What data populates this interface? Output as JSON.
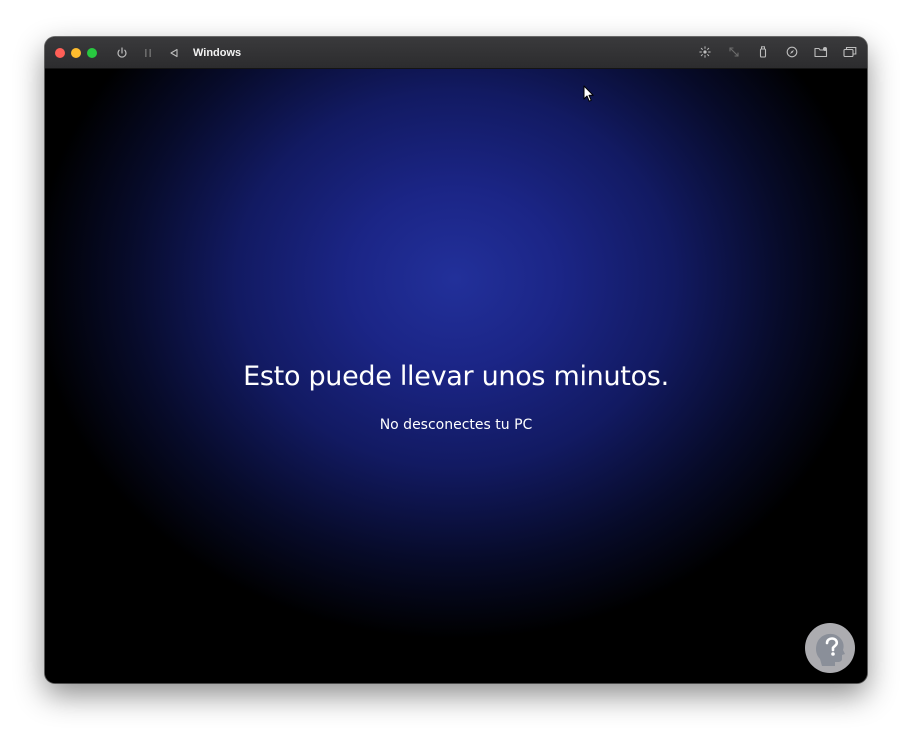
{
  "window": {
    "title": "Windows",
    "traffic_lights": {
      "close": "#ff5f57",
      "minimize": "#febc2e",
      "zoom": "#28c840"
    }
  },
  "toolbar": {
    "left_icons": [
      "power-icon",
      "pause-icon",
      "back-triangle-icon"
    ],
    "right_icons": [
      "brightness-icon",
      "resize-arrows-icon",
      "usb-device-icon",
      "compass-icon",
      "shared-folder-icon",
      "windows-overlay-icon"
    ]
  },
  "screen": {
    "headline": "Esto puede llevar unos minutos.",
    "subtext": "No desconectes tu PC",
    "background_accent": "#22309a"
  },
  "watermark": {
    "icon": "head-question-icon"
  }
}
